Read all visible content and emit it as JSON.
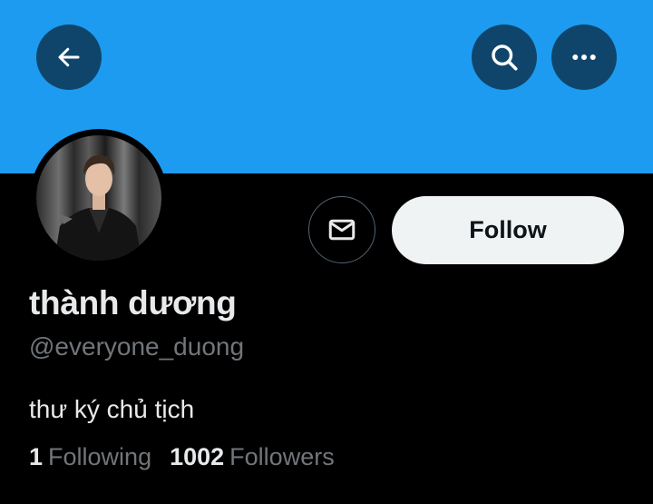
{
  "profile": {
    "display_name": "thành dương",
    "handle": "@everyone_duong",
    "bio": "thư ký chủ tịch",
    "following_count": "1",
    "following_label": "Following",
    "followers_count": "1002",
    "followers_label": "Followers"
  },
  "actions": {
    "follow_label": "Follow"
  },
  "icons": {
    "back": "back-arrow-icon",
    "search": "search-icon",
    "more": "more-options-icon",
    "message": "mail-icon"
  },
  "colors": {
    "banner": "#1d9bf0",
    "header_button": "#10456b",
    "background": "#000000",
    "follow_button": "#eff3f4",
    "secondary_text": "#71767b"
  }
}
